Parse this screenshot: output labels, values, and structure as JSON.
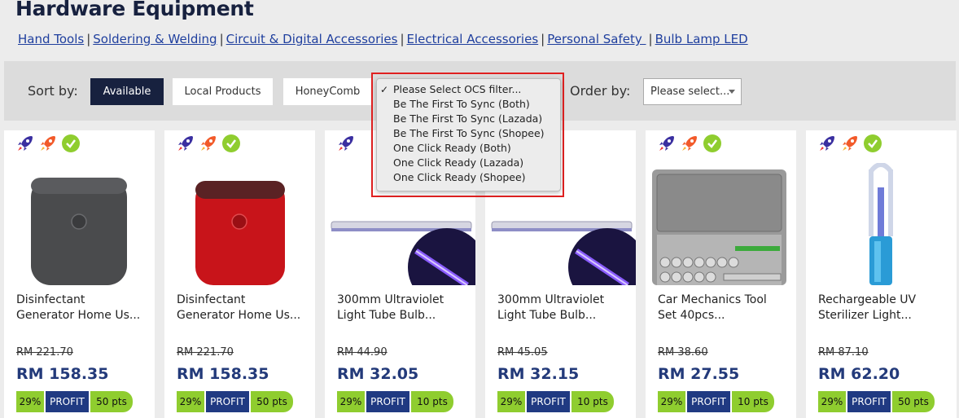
{
  "page": {
    "title": "Hardware Equipment"
  },
  "categories": [
    "Hand Tools",
    "Soldering & Welding",
    "Circuit & Digital Accessories",
    "Electrical Accessories",
    "Personal Safety ",
    "Bulb Lamp LED"
  ],
  "filters": {
    "sort_label": "Sort by:",
    "sort_options": [
      "Available",
      "Local Products",
      "HoneyComb"
    ],
    "active_sort": "Available",
    "order_label": "Order by:",
    "order_value": "Please select..."
  },
  "ocs_filter": {
    "selected": "Please Select OCS filter...",
    "options": [
      "Please Select OCS filter...",
      "Be The First To Sync (Both)",
      "Be The First To Sync (Lazada)",
      "Be The First To Sync (Shopee)",
      "One Click Ready (Both)",
      "One Click Ready (Lazada)",
      "One Click Ready (Shopee)"
    ]
  },
  "badge_icons": [
    "rocket-icon",
    "flame-rocket-icon",
    "check-circle-icon"
  ],
  "colors": {
    "navy": "#17213f",
    "profit": "#203a82",
    "green": "#8fcd2f",
    "highlight": "#e02020"
  },
  "products": [
    {
      "name_line1": "Disinfectant",
      "name_line2": "Generator Home Us...",
      "old_price": "RM 221.70",
      "price": "RM 158.35",
      "pct": "29%",
      "profit": "PROFIT",
      "pts": "50 pts"
    },
    {
      "name_line1": "Disinfectant",
      "name_line2": "Generator Home Us...",
      "old_price": "RM 221.70",
      "price": "RM 158.35",
      "pct": "29%",
      "profit": "PROFIT",
      "pts": "50 pts"
    },
    {
      "name_line1": "300mm Ultraviolet",
      "name_line2": "Light Tube Bulb...",
      "old_price": "RM 44.90",
      "price": "RM 32.05",
      "pct": "29%",
      "profit": "PROFIT",
      "pts": "10 pts"
    },
    {
      "name_line1": "300mm Ultraviolet",
      "name_line2": "Light Tube Bulb...",
      "old_price": "RM 45.05",
      "price": "RM 32.15",
      "pct": "29%",
      "profit": "PROFIT",
      "pts": "10 pts"
    },
    {
      "name_line1": "Car Mechanics Tool",
      "name_line2": "Set 40pcs...",
      "old_price": "RM 38.60",
      "price": "RM 27.55",
      "pct": "29%",
      "profit": "PROFIT",
      "pts": "10 pts"
    },
    {
      "name_line1": "Rechargeable UV",
      "name_line2": "Sterilizer Light...",
      "old_price": "RM 87.10",
      "price": "RM 62.20",
      "pct": "29%",
      "profit": "PROFIT",
      "pts": "50 pts"
    }
  ]
}
